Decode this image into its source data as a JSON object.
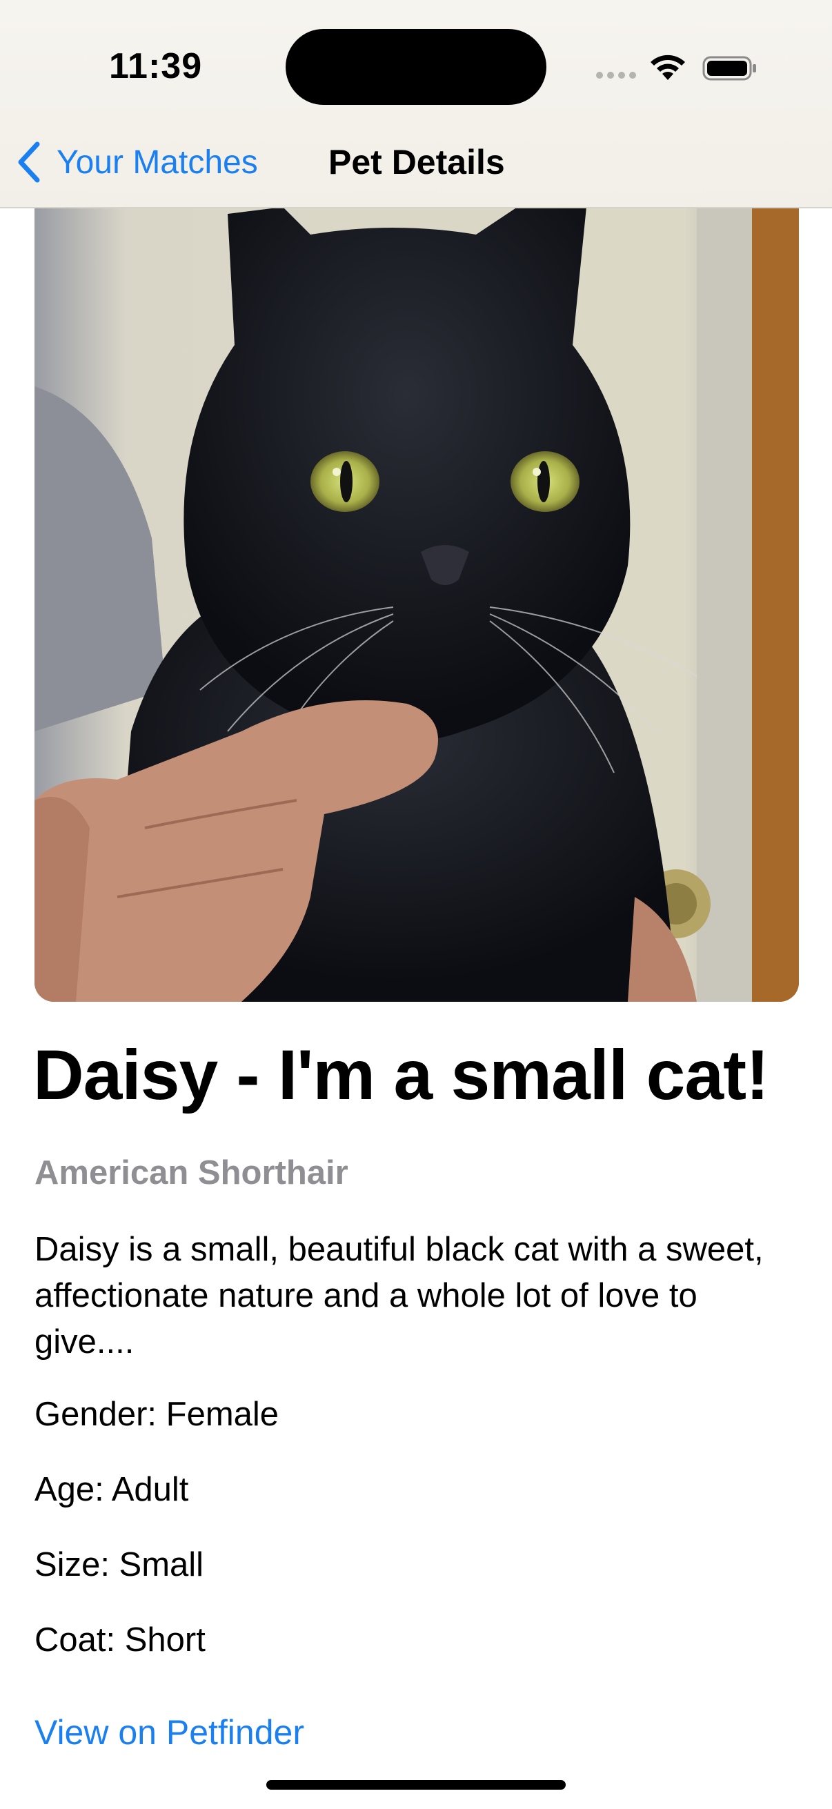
{
  "status_bar": {
    "time": "11:39"
  },
  "nav": {
    "back_label": "Your Matches",
    "title": "Pet Details",
    "accent_color": "#1a7ff0"
  },
  "pet": {
    "name_heading": "Daisy - I'm a small cat!",
    "breed": "American Shorthair",
    "description": "Daisy is a small, beautiful black cat with a sweet, affectionate nature and a whole lot of love to give....",
    "gender": "Gender: Female",
    "age": "Age: Adult",
    "size": "Size: Small",
    "coat": "Coat: Short"
  },
  "links": {
    "petfinder_label": "View on Petfinder"
  },
  "icons": {
    "back": "chevron-left-icon",
    "wifi": "wifi-icon",
    "battery": "battery-icon",
    "signal": "signal-icon"
  }
}
